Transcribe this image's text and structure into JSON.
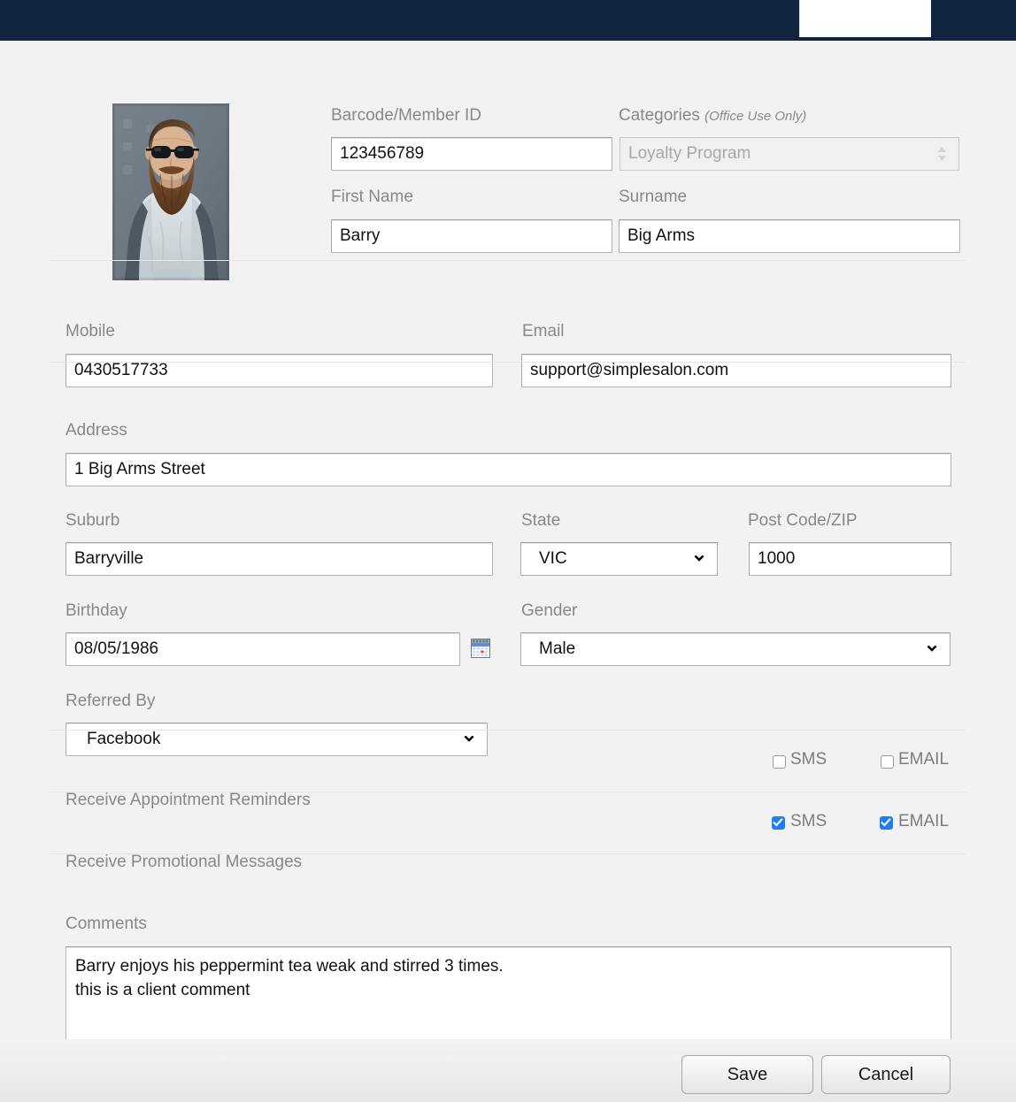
{
  "topbar": {
    "background_color": "#10243f",
    "panel_color": "#ffffff"
  },
  "avatar": {
    "alt": "client profile photo"
  },
  "form": {
    "barcode": {
      "label": "Barcode/Member ID",
      "value": "123456789",
      "placeholder": ""
    },
    "categories": {
      "label": "Categories",
      "label_note": "(Office Use Only)",
      "value": "Loyalty Program",
      "disabled": true
    },
    "first_name": {
      "label": "First Name",
      "value": "Barry",
      "placeholder": ""
    },
    "surname": {
      "label": "Surname",
      "value": "Big Arms",
      "placeholder": ""
    },
    "mobile": {
      "label": "Mobile",
      "value": "0430517733",
      "placeholder": ""
    },
    "email": {
      "label": "Email",
      "value": "support@simplesalon.com",
      "placeholder": ""
    },
    "address": {
      "label": "Address",
      "value": "1 Big Arms Street",
      "placeholder": ""
    },
    "suburb": {
      "label": "Suburb",
      "value": "Barryville",
      "placeholder": ""
    },
    "state": {
      "label": "State",
      "value": "VIC"
    },
    "postcode": {
      "label": "Post Code/ZIP",
      "value": "1000",
      "placeholder": ""
    },
    "birthday": {
      "label": "Birthday",
      "value": "08/05/1986",
      "placeholder": ""
    },
    "gender": {
      "label": "Gender",
      "value": "Male"
    },
    "referred_by": {
      "label": "Referred By",
      "value": "Facebook"
    },
    "appointment_reminders": {
      "label": "Receive Appointment Reminders",
      "sms_label": "SMS",
      "email_label": "EMAIL",
      "sms_checked": false,
      "email_checked": false
    },
    "promotional_messages": {
      "label": "Receive Promotional Messages",
      "sms_label": "SMS",
      "email_label": "EMAIL",
      "sms_checked": true,
      "email_checked": true
    },
    "comments": {
      "label": "Comments",
      "value": "Barry enjoys his peppermint tea weak and stirred 3 times.\nthis is a client comment",
      "placeholder": ""
    }
  },
  "actions": {
    "save_label": "Save",
    "cancel_label": "Cancel"
  },
  "colors": {
    "navy": "#10243f",
    "checkbox_blue": "#1e7ef0",
    "page_background": "#f2f2f2",
    "label_gray": "#888888"
  }
}
